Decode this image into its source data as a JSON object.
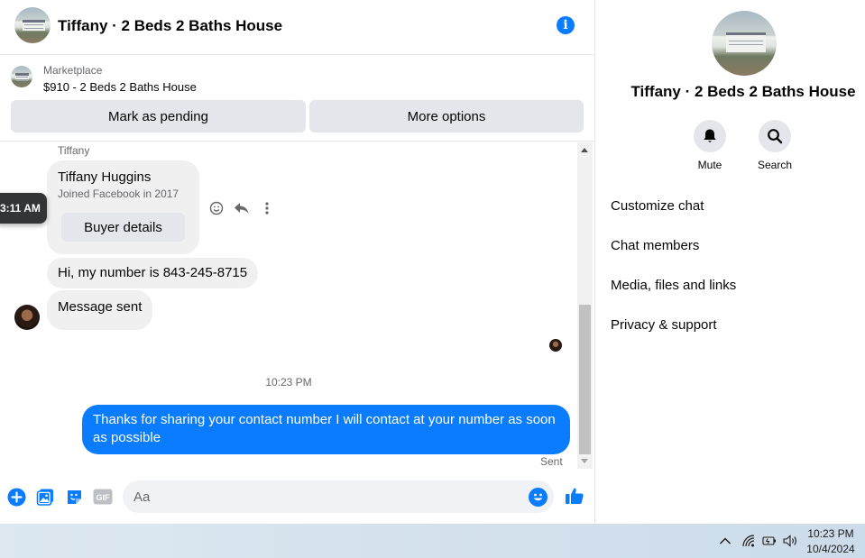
{
  "header": {
    "title": "Tiffany · 2 Beds 2 Baths House"
  },
  "marketplace": {
    "label": "Marketplace",
    "item": "$910 - 2 Beds 2 Baths House",
    "mark_pending": "Mark as pending",
    "more_options": "More options"
  },
  "thread": {
    "sender_name": "Tiffany",
    "card": {
      "name": "Tiffany Huggins",
      "subtitle": "Joined Facebook in 2017",
      "button": "Buyer details"
    },
    "hover_time": "3:11 AM",
    "messages_in": [
      "Hi, my number is 843-245-8715",
      "Message sent"
    ],
    "divider_time": "10:23 PM",
    "message_out": "Thanks for sharing your contact number I will contact at your number as soon as possible",
    "status": "Sent"
  },
  "composer": {
    "placeholder": "Aa"
  },
  "details": {
    "title": "Tiffany · 2 Beds 2 Baths House",
    "mute": "Mute",
    "search": "Search",
    "menu": [
      "Customize chat",
      "Chat members",
      "Media, files and links",
      "Privacy & support"
    ]
  },
  "taskbar": {
    "time": "10:23 PM",
    "date": "10/4/2024"
  },
  "colors": {
    "accent": "#0a7cff",
    "bubble_gray": "#f0f0f0",
    "button_gray": "#e4e6eb"
  }
}
